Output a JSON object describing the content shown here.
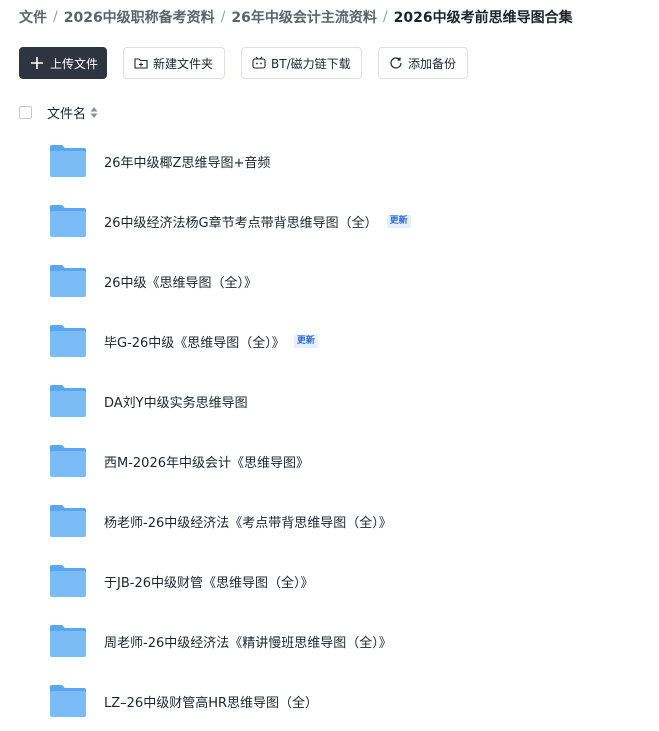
{
  "breadcrumb": [
    {
      "label": "文件"
    },
    {
      "label": "2026中级职称备考资料"
    },
    {
      "label": "26年中级会计主流资料"
    },
    {
      "label": "2026中级考前思维导图合集"
    }
  ],
  "toolbar": {
    "upload_label": "上传文件",
    "new_folder_label": "新建文件夹",
    "bt_label": "BT/磁力链下载",
    "backup_label": "添加备份"
  },
  "list_header": {
    "name_label": "文件名"
  },
  "files": [
    {
      "name": "26年中级椰Z思维导图+音频",
      "badge": ""
    },
    {
      "name": "26中级经济法杨G章节考点带背思维导图（全）",
      "badge": "更新"
    },
    {
      "name": "26中级《思维导图（全）》",
      "badge": ""
    },
    {
      "name": "毕G-26中级《思维导图（全）》",
      "badge": "更新"
    },
    {
      "name": "DA刘Y中级实务思维导图",
      "badge": ""
    },
    {
      "name": "西M-2026年中级会计《思维导图》",
      "badge": ""
    },
    {
      "name": "杨老师-26中级经济法《考点带背思维导图（全）》",
      "badge": ""
    },
    {
      "name": "于JB-26中级财管《思维导图（全）》",
      "badge": ""
    },
    {
      "name": "周老师-26中级经济法《精讲慢班思维导图（全）》",
      "badge": ""
    },
    {
      "name": "LZ–26中级财管高HR思维导图（全）",
      "badge": ""
    }
  ],
  "colors": {
    "folder_back": "#5aa7f0",
    "folder_front": "#7cbcf6",
    "primary_button": "#2f3441",
    "badge_text": "#2b6bd6"
  }
}
